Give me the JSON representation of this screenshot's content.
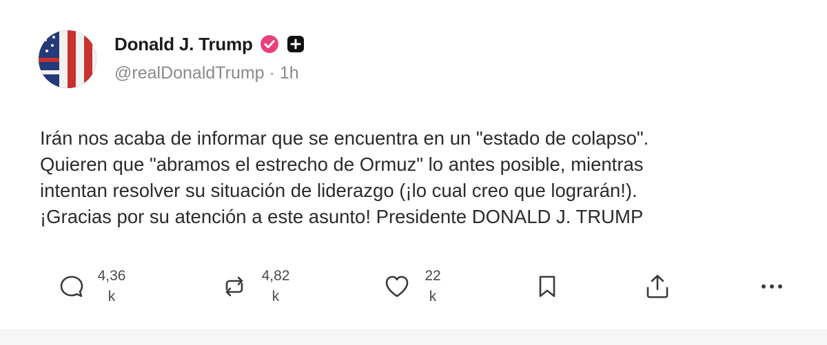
{
  "author": {
    "display_name": "Donald J. Trump",
    "handle": "@realDonaldTrump",
    "separator": "·",
    "time": "1h"
  },
  "post": {
    "lines": [
      "Irán nos acaba de informar que se encuentra en un \"estado de colapso\".",
      "Quieren que \"abramos el estrecho de Ormuz\" lo antes posible, mientras",
      "intentan resolver su situación de liderazgo (¡lo cual creo que lograrán!).",
      "¡Gracias por su atención a este asunto! Presidente DONALD J. TRUMP"
    ]
  },
  "actions": {
    "reply": {
      "icon": "reply-icon",
      "count_line1": "4,36",
      "count_line2": "k"
    },
    "repost": {
      "icon": "repost-icon",
      "count_line1": "4,82",
      "count_line2": "k"
    },
    "like": {
      "icon": "heart-icon",
      "count_line1": "22",
      "count_line2": "k"
    },
    "bookmark": {
      "icon": "bookmark-icon"
    },
    "share": {
      "icon": "share-icon"
    },
    "more": {
      "icon": "more-icon"
    }
  },
  "colors": {
    "verified_badge": "#e8417e",
    "text_primary": "#1b1b1b",
    "text_secondary": "#8a8a8a"
  }
}
